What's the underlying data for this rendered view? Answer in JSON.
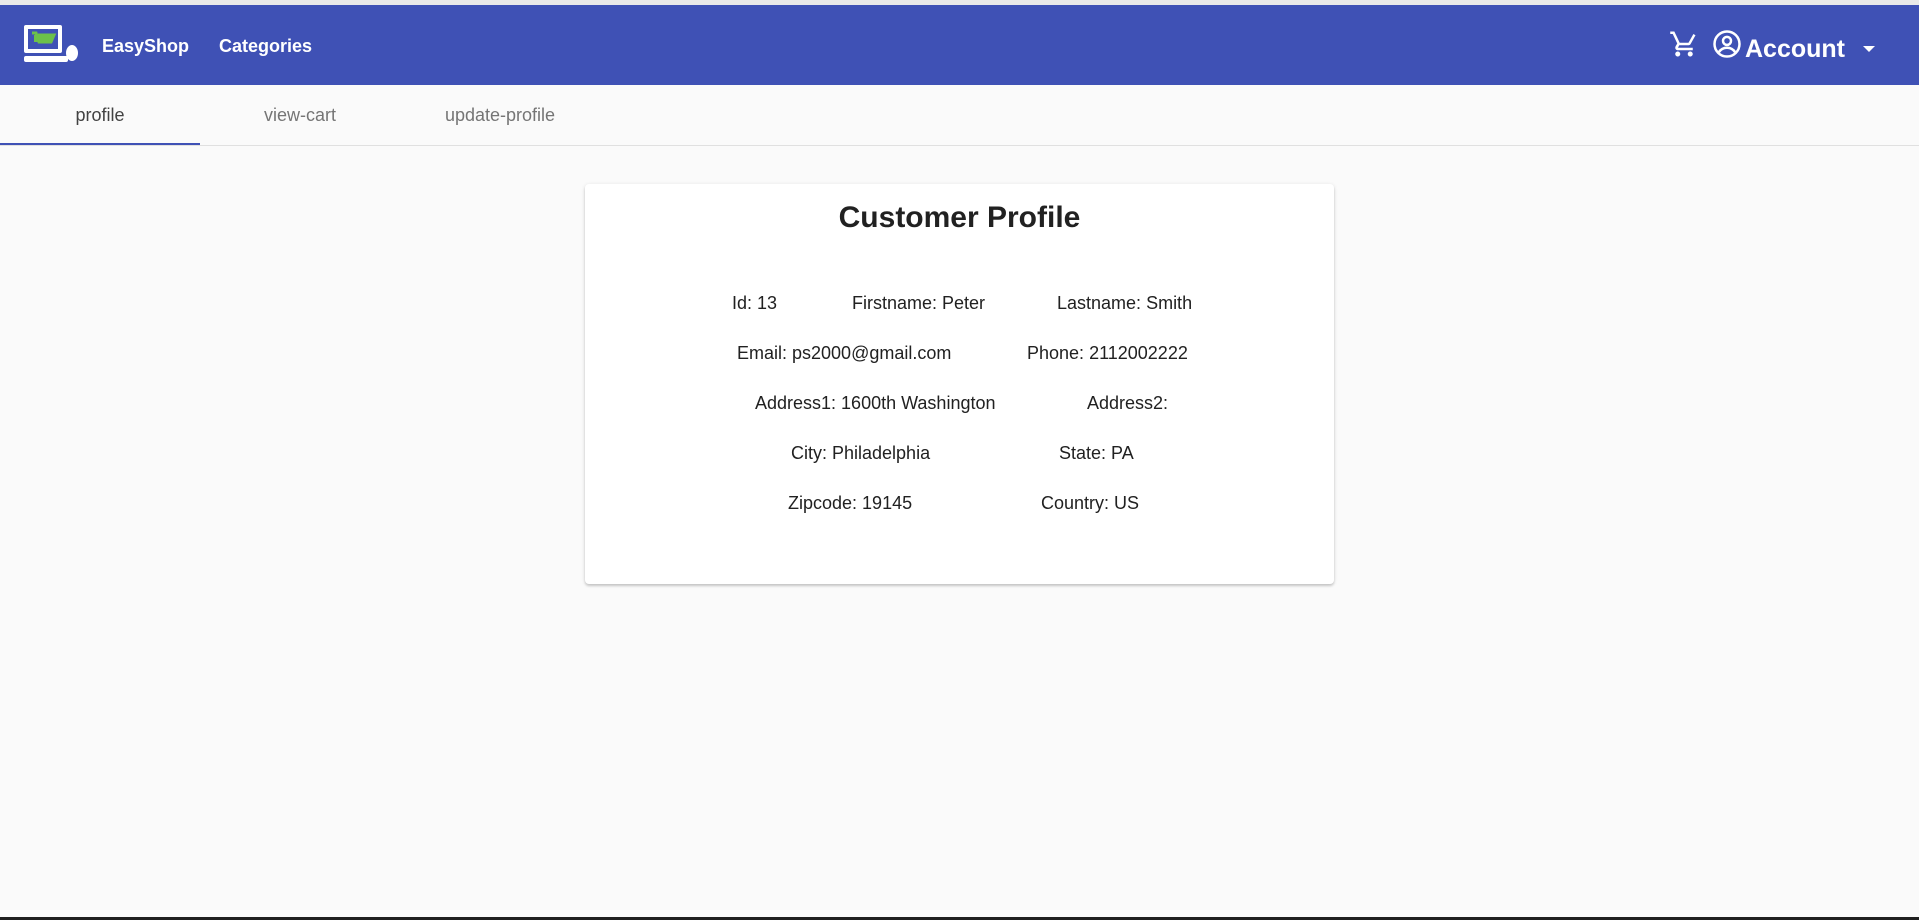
{
  "navbar": {
    "brand_label": "EasyShop",
    "categories_label": "Categories",
    "account_label": "Account",
    "icons": {
      "logo": "easyshop-logo",
      "cart": "shopping-cart-icon",
      "account": "account-circle-icon",
      "caret": "chevron-down-icon"
    },
    "colors": {
      "primary": "#3f51b5",
      "logo_green": "#6cc04a"
    }
  },
  "tabs": [
    {
      "label": "profile",
      "active": true
    },
    {
      "label": "view-cart",
      "active": false
    },
    {
      "label": "update-profile",
      "active": false
    }
  ],
  "profile": {
    "title": "Customer Profile",
    "fields": {
      "id": {
        "label": "Id:",
        "value": "13"
      },
      "firstname": {
        "label": "Firstname:",
        "value": "Peter"
      },
      "lastname": {
        "label": "Lastname:",
        "value": "Smith"
      },
      "email": {
        "label": "Email:",
        "value": "ps2000@gmail.com"
      },
      "phone": {
        "label": "Phone:",
        "value": "2112002222"
      },
      "address1": {
        "label": "Address1:",
        "value": "1600th Washington"
      },
      "address2": {
        "label": "Address2:",
        "value": ""
      },
      "city": {
        "label": "City:",
        "value": "Philadelphia"
      },
      "state": {
        "label": "State:",
        "value": "PA"
      },
      "zipcode": {
        "label": "Zipcode:",
        "value": "19145"
      },
      "country": {
        "label": "Country:",
        "value": "US"
      }
    }
  }
}
